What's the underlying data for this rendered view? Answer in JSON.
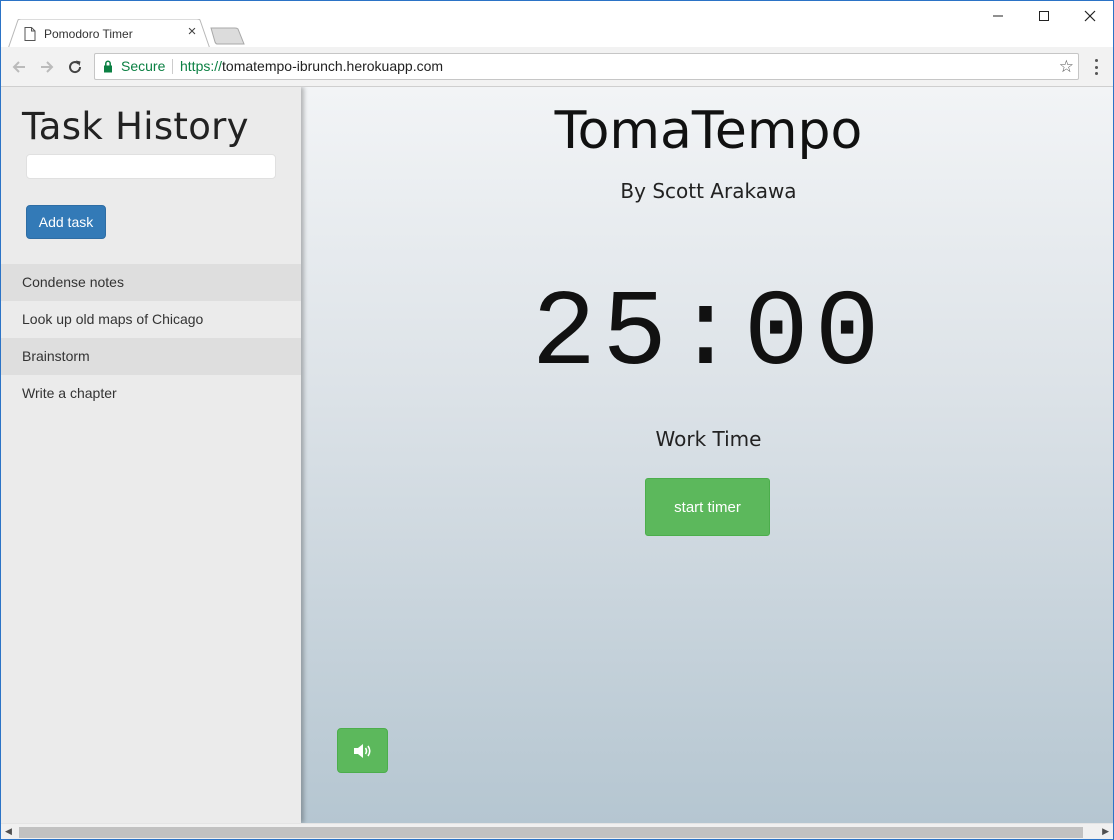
{
  "browser": {
    "tab_title": "Pomodoro Timer",
    "tab_close": "×",
    "security_label": "Secure",
    "url_scheme": "https://",
    "url_host": "tomatempo-ibrunch.herokuapp.com",
    "star": "☆"
  },
  "sidebar": {
    "title": "Task History",
    "input_value": "",
    "add_label": "Add task",
    "tasks": [
      {
        "label": "Condense notes"
      },
      {
        "label": "Look up old maps of Chicago"
      },
      {
        "label": "Brainstorm"
      },
      {
        "label": "Write a chapter"
      }
    ]
  },
  "main": {
    "title": "TomaTempo",
    "byline": "By Scott Arakawa",
    "timer": "25:00",
    "mode": "Work Time",
    "start_label": "start timer",
    "sound_icon": "volume-icon"
  },
  "colors": {
    "primary": "#337ab7",
    "success": "#5cb85c"
  }
}
